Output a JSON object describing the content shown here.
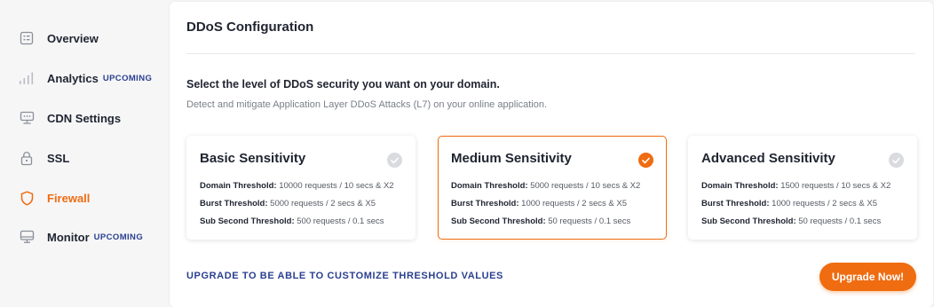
{
  "sidebar": {
    "items": [
      {
        "label": "Overview",
        "badge": "",
        "icon": "overview-icon"
      },
      {
        "label": "Analytics",
        "badge": "UPCOMING",
        "icon": "analytics-icon"
      },
      {
        "label": "CDN Settings",
        "badge": "",
        "icon": "cdn-icon"
      },
      {
        "label": "SSL",
        "badge": "",
        "icon": "lock-icon"
      },
      {
        "label": "Firewall",
        "badge": "",
        "icon": "shield-icon",
        "active": true
      },
      {
        "label": "Monitor",
        "badge": "UPCOMING",
        "icon": "monitor-icon"
      }
    ]
  },
  "panel": {
    "title": "DDoS Configuration",
    "heading": "Select the level of DDoS security you want on your domain.",
    "description": "Detect and mitigate Application Layer DDoS Attacks (L7) on your online application.",
    "cards": [
      {
        "title": "Basic Sensitivity",
        "selected": false,
        "domain_label": "Domain Threshold:",
        "domain_value": " 10000 requests / 10 secs & X2",
        "burst_label": "Burst Threshold:",
        "burst_value": " 5000 requests / 2 secs & X5",
        "subsecond_label": "Sub Second Threshold:",
        "subsecond_value": " 500 requests / 0.1 secs"
      },
      {
        "title": "Medium Sensitivity",
        "selected": true,
        "domain_label": "Domain Threshold:",
        "domain_value": " 5000 requests / 10 secs & X2",
        "burst_label": "Burst Threshold:",
        "burst_value": " 1000 requests / 2 secs & X5",
        "subsecond_label": "Sub Second Threshold:",
        "subsecond_value": " 50 requests / 0.1 secs"
      },
      {
        "title": "Advanced Sensitivity",
        "selected": false,
        "domain_label": "Domain Threshold:",
        "domain_value": " 1500 requests / 10 secs & X2",
        "burst_label": "Burst Threshold:",
        "burst_value": " 1000 requests / 2 secs & X5",
        "subsecond_label": "Sub Second Threshold:",
        "subsecond_value": " 50 requests / 0.1 secs"
      }
    ],
    "upgrade_note": "UPGRADE TO BE ABLE TO CUSTOMIZE THRESHOLD VALUES",
    "upgrade_button": "Upgrade Now!"
  },
  "colors": {
    "accent": "#ef6c11",
    "navy": "#2a3f8f",
    "check_inactive": "#d9dbdf"
  }
}
